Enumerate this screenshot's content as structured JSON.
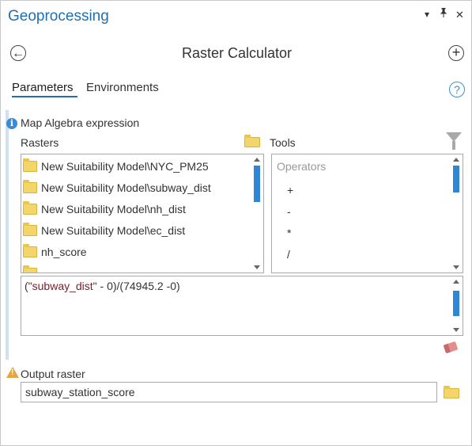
{
  "pane": {
    "title": "Geoprocessing",
    "menu_glyph": "▾",
    "pin_glyph": "📌",
    "close_glyph": "✕"
  },
  "tool": {
    "title": "Raster Calculator",
    "back_glyph": "←",
    "add_glyph": "+",
    "help_glyph": "?"
  },
  "tabs": [
    {
      "label": "Parameters",
      "active": true
    },
    {
      "label": "Environments",
      "active": false
    }
  ],
  "map_algebra": {
    "label": "Map Algebra expression",
    "info_glyph": "i",
    "rasters_label": "Rasters",
    "tools_label": "Tools",
    "rasters": [
      "New Suitability Model\\NYC_PM25",
      "New Suitability Model\\subway_dist",
      "New Suitability Model\\nh_dist",
      "New Suitability Model\\ec_dist",
      "nh_score"
    ],
    "operators_header": "Operators",
    "operators": [
      "+",
      "-",
      "*",
      "/"
    ],
    "expression": {
      "open": "(",
      "quoted": "\"subway_dist\"",
      "rest": " - 0)/(74945.2 -0)"
    }
  },
  "output": {
    "label": "Output raster",
    "warn_glyph": "!",
    "value": "subway_station_score"
  },
  "colors": {
    "accent": "#1f6fb2",
    "scrollbar": "#2f86d4",
    "folder": "#f3d56a",
    "warning": "#e2a646",
    "quoted_text": "#7a1c2a"
  }
}
